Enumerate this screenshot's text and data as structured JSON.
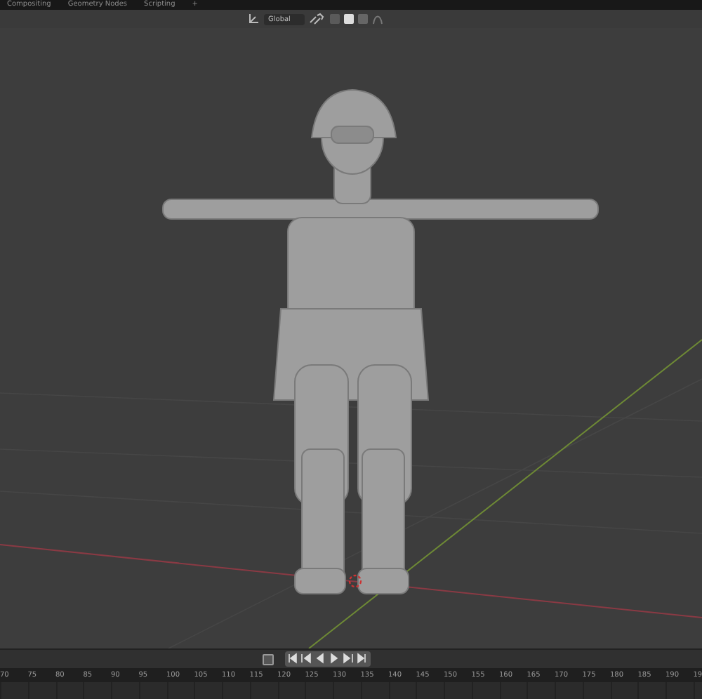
{
  "workspace_tabs": [
    {
      "label": "Compositing",
      "selected": false
    },
    {
      "label": "Geometry Nodes",
      "selected": false
    },
    {
      "label": "Scripting",
      "selected": false
    },
    {
      "label": "+",
      "selected": false
    }
  ],
  "header": {
    "orientation": "Global"
  },
  "timeline": {
    "ticks": [
      "70",
      "75",
      "80",
      "85",
      "90",
      "95",
      "100",
      "105",
      "110",
      "115",
      "120",
      "125",
      "130",
      "135",
      "140",
      "145",
      "150",
      "155",
      "160",
      "165",
      "170",
      "175",
      "180",
      "185",
      "190",
      "19"
    ]
  }
}
